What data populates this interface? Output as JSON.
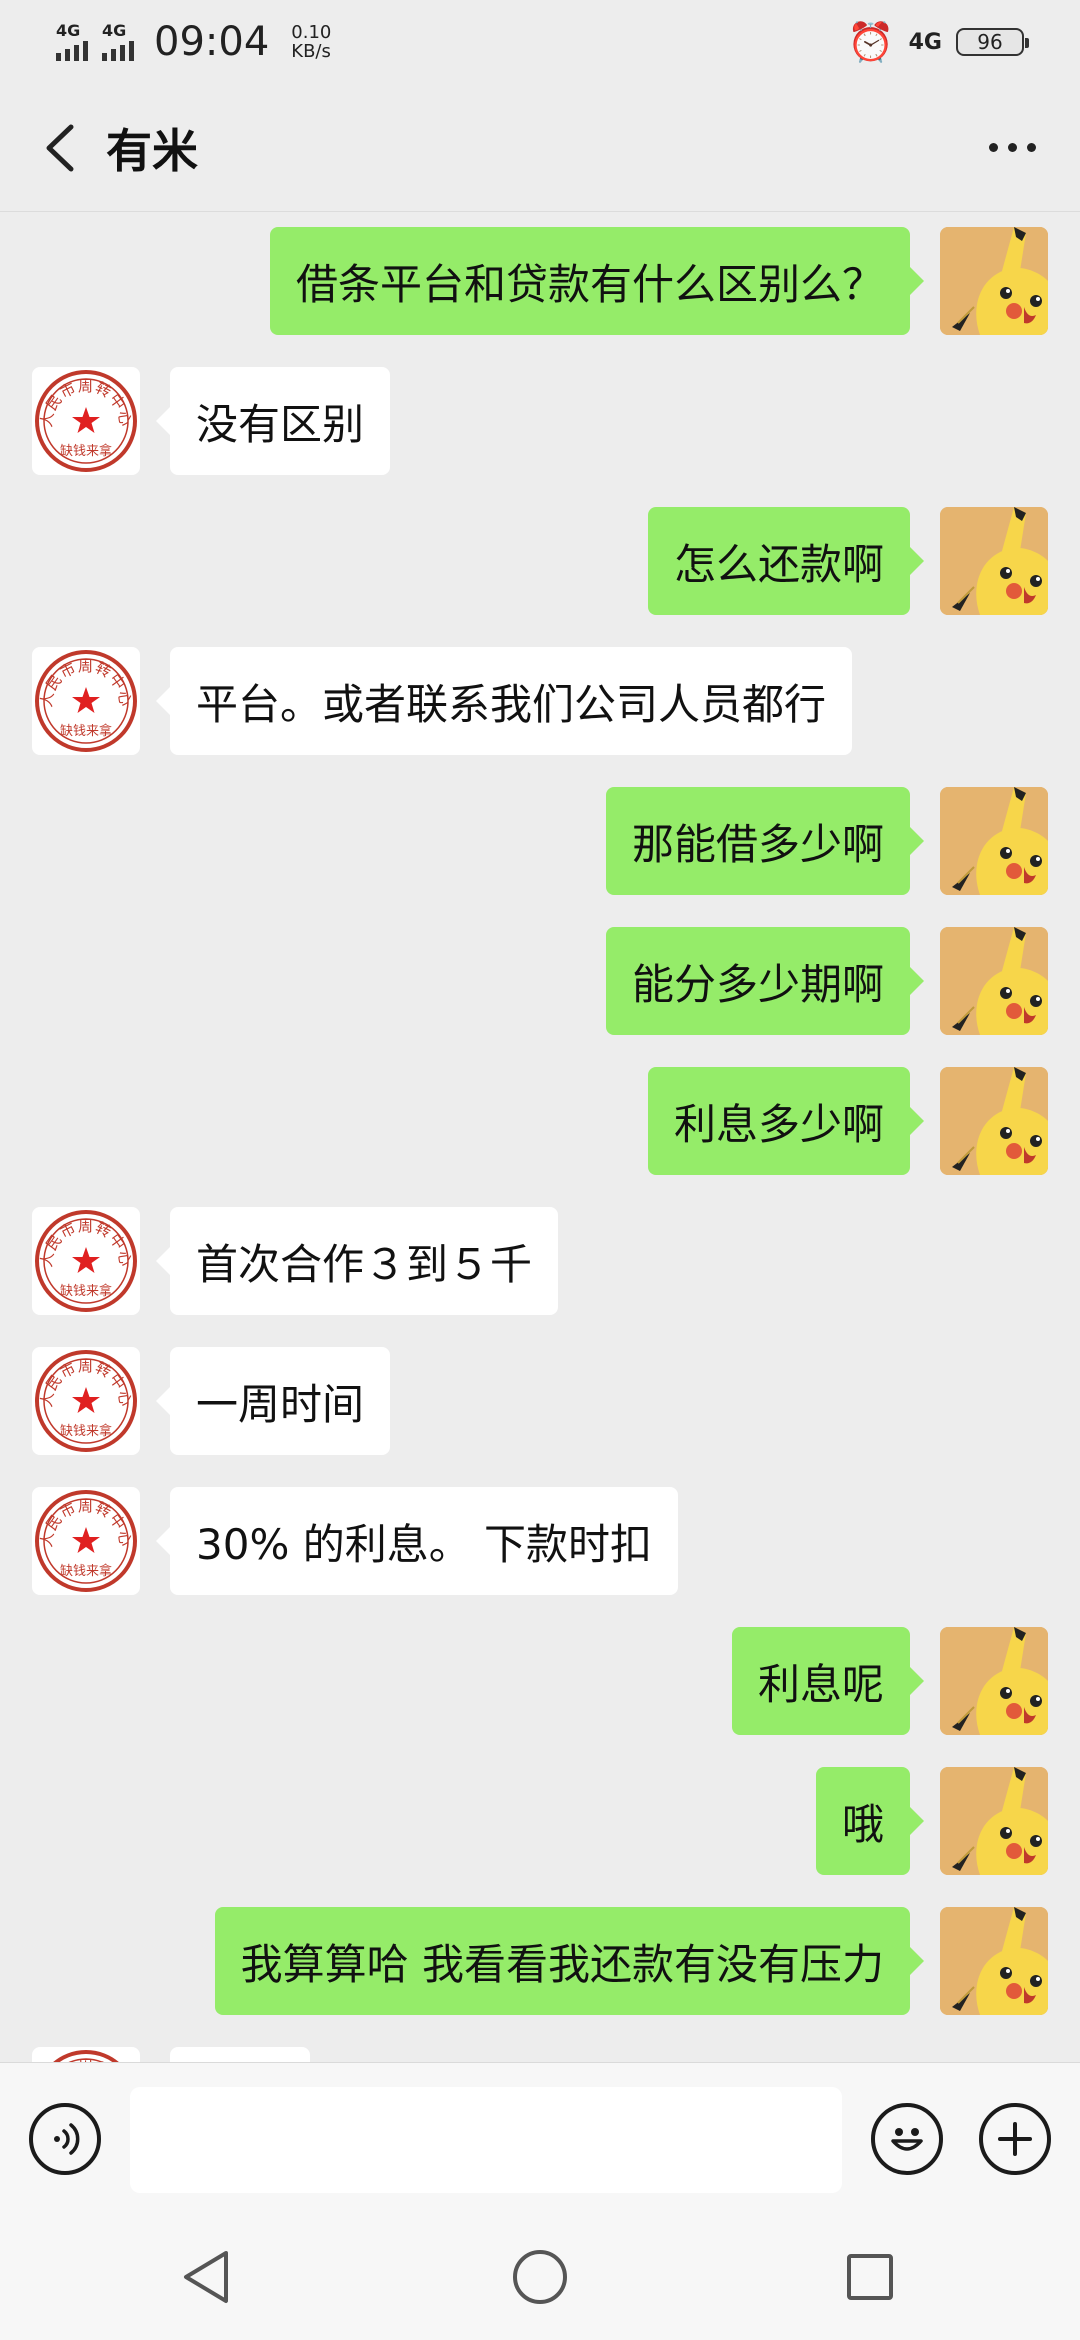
{
  "status_bar": {
    "net1": "4G",
    "net2": "4G",
    "time": "09:04",
    "speed_value": "0.10",
    "speed_unit": "KB/s",
    "right_net": "4G",
    "battery": "96"
  },
  "header": {
    "title": "有米"
  },
  "avatars": {
    "contact_seal_top": "人民市周转中心",
    "contact_seal_bottom": "缺钱来拿"
  },
  "messages": [
    {
      "side": "right",
      "text": "借条平台和贷款有什么区别么？"
    },
    {
      "side": "left",
      "text": "没有区别"
    },
    {
      "side": "right",
      "text": "怎么还款啊"
    },
    {
      "side": "left",
      "text": "平台。或者联系我们公司人员都行"
    },
    {
      "side": "right",
      "text": "那能借多少啊"
    },
    {
      "side": "right",
      "text": "能分多少期啊"
    },
    {
      "side": "right",
      "text": "利息多少啊"
    },
    {
      "side": "left",
      "text": "首次合作３到５千"
    },
    {
      "side": "left",
      "text": "一周时间"
    },
    {
      "side": "left",
      "text": "30% 的利息。 下款时扣"
    },
    {
      "side": "right",
      "text": "利息呢"
    },
    {
      "side": "right",
      "text": "哦"
    },
    {
      "side": "right",
      "text": "我算算哈 我看看我还款有没有压力"
    }
  ],
  "colors": {
    "background": "#ededed",
    "sent_bubble": "#95ec69",
    "received_bubble": "#ffffff",
    "seal_red": "#c0392b"
  },
  "icons": {
    "back": "chevron-left-icon",
    "more": "more-icon",
    "voice": "voice-icon",
    "emoji": "emoji-icon",
    "plus": "plus-icon",
    "alarm": "alarm-icon"
  }
}
